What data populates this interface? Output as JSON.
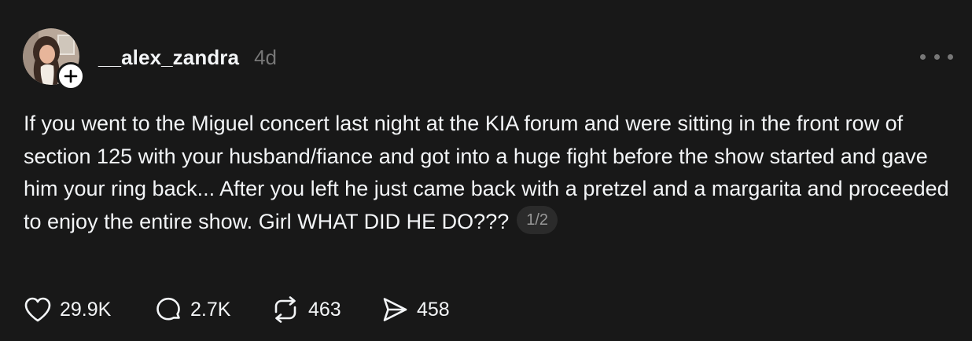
{
  "post": {
    "username": "__alex_zandra",
    "timestamp": "4d",
    "text": "If you went to the Miguel concert last night at the KIA forum and were sitting in the front row of section 125 with your husband/fiance and got into a huge fight before the show started and gave him your ring back... After you left he just came back with a pretzel and a margarita and proceeded to enjoy the entire show. Girl WHAT DID HE DO???",
    "page_indicator": "1/2"
  },
  "actions": {
    "likes": "29.9K",
    "replies": "2.7K",
    "reposts": "463",
    "shares": "458"
  },
  "icons": {
    "avatar": "avatar-photo",
    "follow": "plus-icon",
    "more": "more-horizontal-icon",
    "like": "heart-icon",
    "reply": "comment-bubble-icon",
    "repost": "repost-icon",
    "share": "send-icon"
  },
  "colors": {
    "background": "#181818",
    "text": "#f3f5f7",
    "muted": "#777777",
    "pill": "#2b2b2b"
  }
}
